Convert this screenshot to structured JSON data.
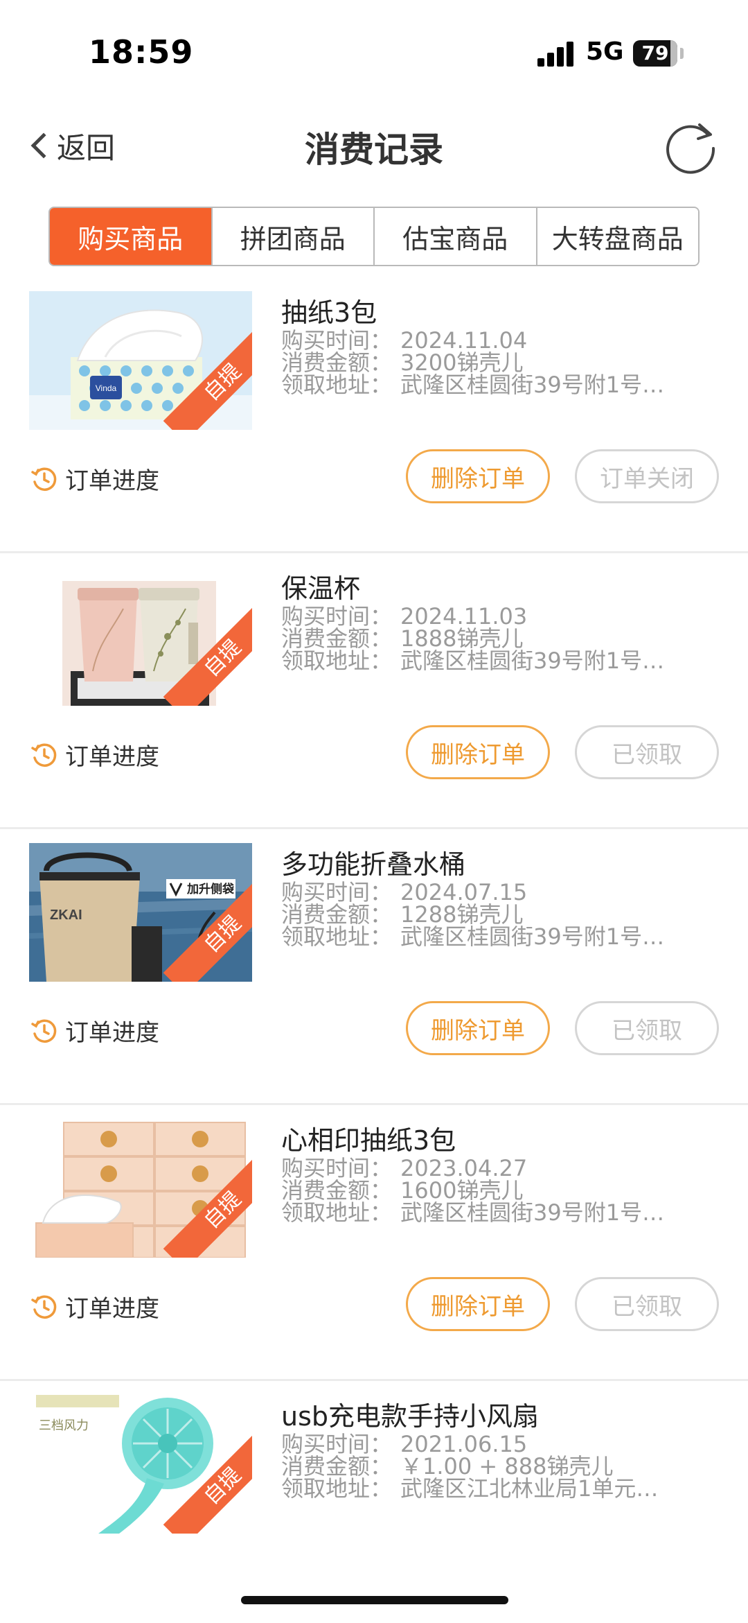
{
  "status_bar": {
    "time": "18:59",
    "network": "5G",
    "battery": "79"
  },
  "header": {
    "back_label": "返回",
    "title": "消费记录"
  },
  "tabs": [
    {
      "label": "购买商品",
      "active": true
    },
    {
      "label": "拼团商品",
      "active": false
    },
    {
      "label": "估宝商品",
      "active": false
    },
    {
      "label": "大转盘商品",
      "active": false
    }
  ],
  "labels": {
    "time": "购买时间：",
    "amount": "消费金额：",
    "address": "领取地址：",
    "progress": "订单进度",
    "delete": "删除订单",
    "pickup_badge": "自提"
  },
  "orders": [
    {
      "name": "抽纸3包",
      "time": "2024.11.04",
      "amount": "3200锑壳儿",
      "address": "武隆区桂圆街39号附1号…",
      "status": "订单关闭"
    },
    {
      "name": "保温杯",
      "time": "2024.11.03",
      "amount": "1888锑壳儿",
      "address": "武隆区桂圆街39号附1号…",
      "status": "已领取"
    },
    {
      "name": "多功能折叠水桶",
      "time": "2024.07.15",
      "amount": "1288锑壳儿",
      "address": "武隆区桂圆街39号附1号…",
      "status": "已领取"
    },
    {
      "name": "心相印抽纸3包",
      "time": "2023.04.27",
      "amount": "1600锑壳儿",
      "address": "武隆区桂圆街39号附1号…",
      "status": "已领取"
    },
    {
      "name": "usb充电款手持小风扇",
      "time": "2021.06.15",
      "amount": "￥1.00 + 888锑壳儿",
      "address": "武隆区江北林业局1单元…",
      "status": ""
    }
  ],
  "image_text": {
    "tissue_brand": "Vinda",
    "bucket_brand": "ZKAI",
    "bucket_tag": "加升侧袋",
    "fan_tag": "三档风力"
  },
  "colors": {
    "accent": "#f5612b",
    "delete_border": "#f3a94a",
    "muted": "#9a9a9a"
  }
}
